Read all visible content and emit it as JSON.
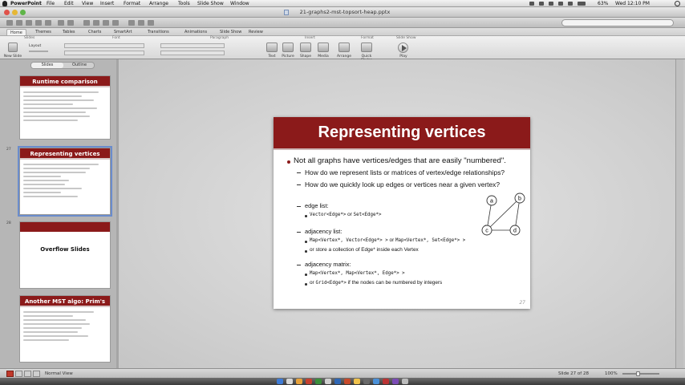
{
  "menubar": {
    "app": "PowerPoint",
    "items": [
      "File",
      "Edit",
      "View",
      "Insert",
      "Format",
      "Arrange",
      "Tools",
      "Slide Show",
      "Window"
    ],
    "battery": "63%",
    "clock": "Wed 12:10 PM"
  },
  "window": {
    "title": "21-graphs2-mst-topsort-heap.pptx"
  },
  "ribbon": {
    "tabs": [
      "Home",
      "Themes",
      "Tables",
      "Charts",
      "SmartArt",
      "Transitions",
      "Animations",
      "Slide Show",
      "Review"
    ],
    "active_tab": "Home",
    "groups": [
      "Slides",
      "Font",
      "Paragraph",
      "Insert",
      "Format",
      "Slide Show"
    ],
    "new_slide": "New Slide",
    "layout": "Layout",
    "insert_buttons": [
      "Text",
      "Picture",
      "Shape",
      "Media",
      "Arrange",
      "Quick Styles",
      "Play"
    ]
  },
  "sidebar": {
    "tabs": [
      "Slides",
      "Outline"
    ],
    "active_tab": "Slides",
    "thumbnails": [
      {
        "title": "Runtime comparison"
      },
      {
        "title": "Representing vertices",
        "number": "27"
      },
      {
        "title": "Overflow Slides",
        "number": "28"
      },
      {
        "title": "Another MST algo: Prim's"
      }
    ]
  },
  "slide": {
    "title": "Representing vertices",
    "bullet_main": "Not all graphs have vertices/edges that are easily \"numbered\".",
    "sub1": "How do we represent lists or matrices of vertex/edge relationships?",
    "sub2": "How do we quickly look up edges or vertices near a given vertex?",
    "edge_list_heading": "edge list:",
    "edge_list_item_a": "Vector<Edge*>",
    "edge_list_item_or": " or ",
    "edge_list_item_b": "Set<Edge*>",
    "adj_list_heading": "adjacency list:",
    "adj_list_item_a": "Map<Vertex*, Vector<Edge*> >",
    "adj_list_item_or": " or ",
    "adj_list_item_b": "Map<Vertex*, Set<Edge*> >",
    "adj_list_item2": "or store a collection of Edge* inside each Vertex",
    "adj_matrix_heading": "adjacency matrix:",
    "adj_matrix_item_a": "Map<Vertex*, Map<Vertex*, Edge*> >",
    "adj_matrix_item2_code": "Grid<Edge*>",
    "adj_matrix_item2_pre": "or ",
    "adj_matrix_item2_post": " if the nodes can be numbered by integers",
    "graph_nodes": [
      "a",
      "b",
      "c",
      "d"
    ],
    "page_number": "27"
  },
  "statusbar": {
    "view": "Normal View",
    "slide_counter": "Slide 27 of 28",
    "zoom": "100%"
  }
}
